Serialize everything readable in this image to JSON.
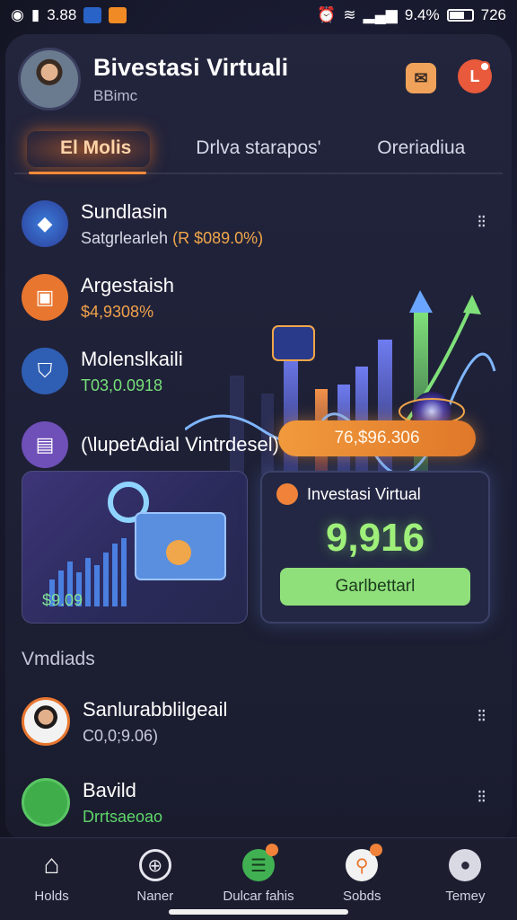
{
  "status_bar": {
    "time_left": "3.88",
    "battery": "9.4%",
    "time_right": "726"
  },
  "header": {
    "title": "Bivestasi Virtuali",
    "subtitle": "BBimc"
  },
  "tabs": [
    {
      "label": "El Molis"
    },
    {
      "label": "Drlva starapos'"
    },
    {
      "label": "Oreriadiua"
    }
  ],
  "assets": [
    {
      "name": "Sundlasin",
      "value": "Satgrlearleh",
      "value_accent": "(R $089.0%)"
    },
    {
      "name": "Argestaish",
      "value": "$4,9308%"
    },
    {
      "name": "Molenslkaili",
      "value": "T03,0.0918"
    },
    {
      "name": "(\\lupetAdial Vintrdesel)",
      "value": ""
    }
  ],
  "more_label": "⁝⁝",
  "highlight_pill": "76,$96.306",
  "left_card": {
    "value": "$9.09"
  },
  "right_card": {
    "title": "Investasi Virtual",
    "amount": "9,916",
    "button": "Garlbettarl"
  },
  "section": {
    "title": "Vmdiads"
  },
  "people": [
    {
      "name": "Sanlurabblilgeail",
      "value": "C0,0;9.06)"
    },
    {
      "name": "Bavild",
      "value": "Drrtsaeoao"
    }
  ],
  "nav": [
    {
      "label": "Holds",
      "icon": "home-icon"
    },
    {
      "label": "Naner",
      "icon": "globe-icon"
    },
    {
      "label": "Dulcar fahis",
      "icon": "list-icon"
    },
    {
      "label": "Sobds",
      "icon": "search-icon"
    },
    {
      "label": "Temey",
      "icon": "user-icon"
    }
  ],
  "colors": {
    "accent_orange": "#e8762f",
    "accent_green": "#8fe07a",
    "background": "#1b1d36"
  }
}
